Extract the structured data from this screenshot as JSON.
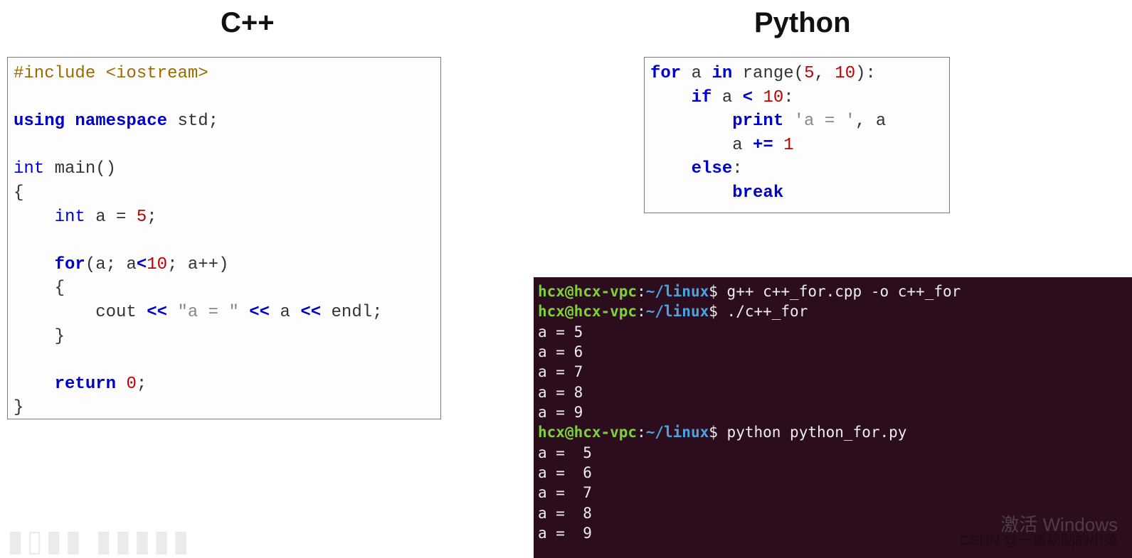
{
  "headings": {
    "cpp": "C++",
    "python": "Python"
  },
  "cpp_code": {
    "l01_pp": "#include ",
    "l01_hdr": "<iostream>",
    "l03_kw1": "using",
    "l03_kw2": "namespace",
    "l03_ns": " std;",
    "l05_type": "int",
    "l05_fn": " main()",
    "l06_brace": "{",
    "l07_indent": "    ",
    "l07_type": "int",
    "l07_rest": " a = ",
    "l07_num": "5",
    "l07_semi": ";",
    "l09_indent": "    ",
    "l09_kw": "for",
    "l09_open": "(a; a",
    "l09_lt": "<",
    "l09_num": "10",
    "l09_close": "; a++)",
    "l10": "    {",
    "l11_indent": "        ",
    "l11_cout": "cout ",
    "l11_op1": "<<",
    "l11_sp1": " ",
    "l11_str": "\"a = \"",
    "l11_sp2": " ",
    "l11_op2": "<<",
    "l11_a": " a ",
    "l11_op3": "<<",
    "l11_endl": " endl;",
    "l12": "    }",
    "l14_indent": "    ",
    "l14_kw": "return",
    "l14_sp": " ",
    "l14_num": "0",
    "l14_semi": ";",
    "l15_brace": "}"
  },
  "py_code": {
    "l1_kw1": "for",
    "l1_mid": " a ",
    "l1_kw2": "in",
    "l1_fn": " range(",
    "l1_n1": "5",
    "l1_c": ", ",
    "l1_n2": "10",
    "l1_end": "):",
    "l2_indent": "    ",
    "l2_kw": "if",
    "l2_mid": " a ",
    "l2_op": "<",
    "l2_sp": " ",
    "l2_num": "10",
    "l2_col": ":",
    "l3_indent": "        ",
    "l3_kw": "print",
    "l3_sp": " ",
    "l3_str": "'a = '",
    "l3_rest": ", a",
    "l4_indent": "        ",
    "l4_a": "a ",
    "l4_op": "+=",
    "l4_sp": " ",
    "l4_num": "1",
    "l5_indent": "    ",
    "l5_kw": "else",
    "l5_col": ":",
    "l6_indent": "        ",
    "l6_kw": "break"
  },
  "terminal": {
    "user": "hcx@hcx-vpc",
    "colon": ":",
    "path": "~/linux",
    "dollar": "$ ",
    "cmd1": "g++ c++_for.cpp -o c++_for",
    "cmd2": "./c++_for",
    "out_cpp": [
      "a = 5",
      "a = 6",
      "a = 7",
      "a = 8",
      "a = 9"
    ],
    "cmd3": "python python_for.py",
    "out_py": [
      "a =  5",
      "a =  6",
      "a =  7",
      "a =  8",
      "a =  9"
    ]
  },
  "watermarks": {
    "logo": "▮▯▮▮  ▮▮▮▮▮",
    "csdn": "CSDN @一道秘制的小菜",
    "activate": "激活 Windows"
  }
}
